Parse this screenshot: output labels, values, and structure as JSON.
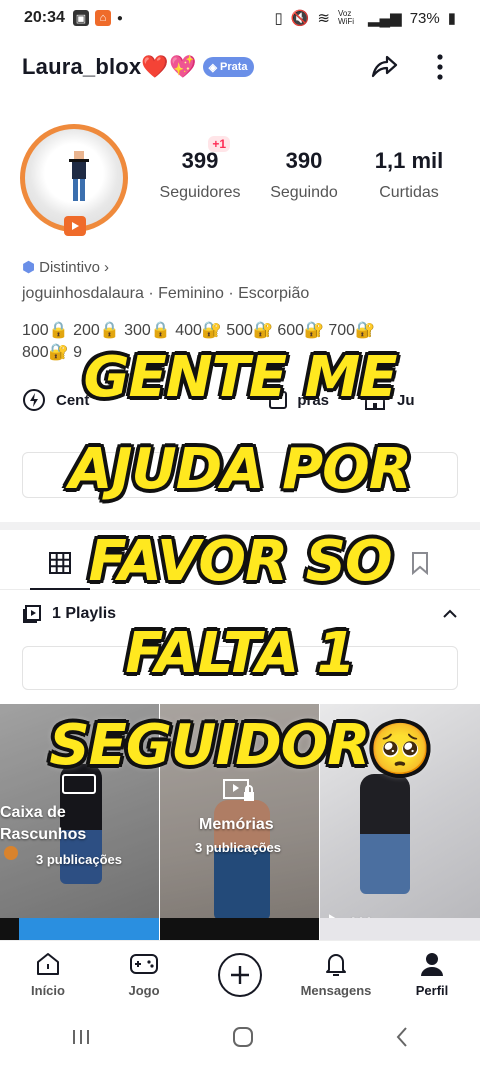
{
  "status_bar": {
    "time": "20:34",
    "battery": "73%",
    "network": "Voz WiFi"
  },
  "header": {
    "username": "Laura_blox❤️💖",
    "badge_label": "Prata"
  },
  "stats": {
    "followers": {
      "value": "399",
      "label": "Seguidores",
      "delta": "+1"
    },
    "following": {
      "value": "390",
      "label": "Seguindo"
    },
    "likes": {
      "value": "1,1 mil",
      "label": "Curtidas"
    }
  },
  "profile": {
    "distintivo": "Distintivo",
    "bio": "joguinhosdalaura · Feminino · Escorpião",
    "levels_line1": "100🔒 200🔒 300🔒 400🔐 500🔐 600🔐 700🔐",
    "levels_line2": "800🔐 9"
  },
  "links": {
    "center_label": "Cent",
    "compras_label": "pras",
    "third_label": "Ju"
  },
  "playlist": {
    "label": "1 Playlis"
  },
  "grid": {
    "drafts": {
      "title_line1": "Caixa de",
      "title_line2": "Rascunhos",
      "count": "3 publicações"
    },
    "memories": {
      "title": "Memórias",
      "count": "3 publicações"
    },
    "video": {
      "views": "444"
    }
  },
  "bottom_nav": [
    {
      "label": "Início",
      "icon": "home-icon"
    },
    {
      "label": "Jogo",
      "icon": "gamepad-icon"
    },
    {
      "label": "",
      "icon": "plus-icon"
    },
    {
      "label": "Mensagens",
      "icon": "bell-icon"
    },
    {
      "label": "Perfil",
      "icon": "person-icon"
    }
  ],
  "overlay": {
    "line1": "GENTE ME",
    "line2": "AJUDA POR",
    "line3": "FAVOR SO",
    "line4": "FALTA 1",
    "line5": "SEGUIDOR",
    "emoji": "🥺"
  },
  "colors": {
    "accent": "#fe2c55",
    "overlay_text": "#ffe81f",
    "avatar_ring": "#ef8a3c",
    "badge": "#6a8fe8"
  }
}
